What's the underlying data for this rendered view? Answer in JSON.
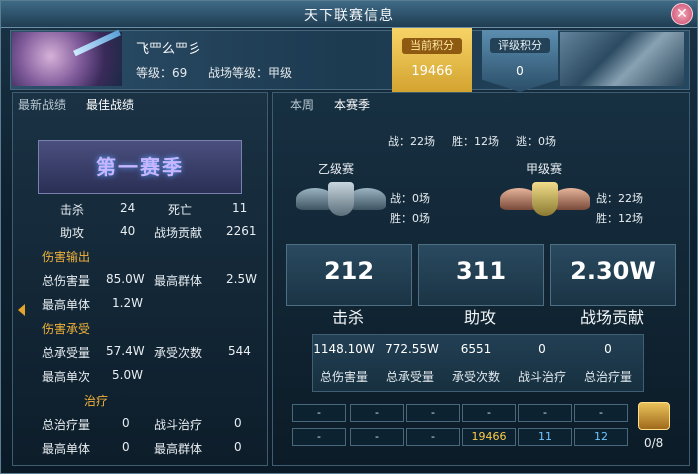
{
  "window": {
    "title": "天下联赛信息"
  },
  "player": {
    "name": "飞罒么罒彡",
    "level": "等级：69",
    "battle_level": "战场等级：甲级"
  },
  "scores": {
    "current_label": "当前积分",
    "current_value": "19466",
    "rating_label": "评级积分",
    "rating_value": "0"
  },
  "left_tabs": [
    "最新战绩",
    "最佳战绩"
  ],
  "right_tabs": [
    "本周",
    "本赛季"
  ],
  "season_banner": "第一赛季",
  "left_stats": {
    "kills_label": "击杀",
    "kills": "24",
    "deaths_label": "死亡",
    "deaths": "11",
    "assists_label": "助攻",
    "assists": "40",
    "contrib_label": "战场贡献",
    "contrib": "2261",
    "damage_section": "伤害输出",
    "total_damage_label": "总伤害量",
    "total_damage": "85.0W",
    "max_aoe_label": "最高群体",
    "max_aoe": "2.5W",
    "max_single_label": "最高单体",
    "max_single": "1.2W",
    "taken_section": "伤害承受",
    "total_taken_label": "总承受量",
    "total_taken": "57.4W",
    "taken_count_label": "承受次数",
    "taken_count": "544",
    "max_taken_label": "最高单次",
    "max_taken": "5.0W",
    "heal_section": "治疗",
    "total_heal_label": "总治疗量",
    "total_heal": "0",
    "battle_heal_label": "战斗治疗",
    "battle_heal": "0",
    "heal_single_label": "最高单体",
    "heal_single": "0",
    "heal_aoe_label": "最高群体",
    "heal_aoe": "0"
  },
  "summary": {
    "battles": "战：22场",
    "wins": "胜：12场",
    "escapes": "逃：0场"
  },
  "leagues": {
    "b": {
      "name": "乙级赛",
      "battles": "战：0场",
      "wins": "胜：0场"
    },
    "a": {
      "name": "甲级赛",
      "battles": "战：22场",
      "wins": "胜：12场"
    }
  },
  "big_stats": [
    {
      "value": "212",
      "label": "击杀"
    },
    {
      "value": "311",
      "label": "助攻"
    },
    {
      "value": "2.30W",
      "label": "战场贡献"
    }
  ],
  "detail_stats": [
    {
      "value": "1148.10W",
      "label": "总伤害量"
    },
    {
      "value": "772.55W",
      "label": "总承受量"
    },
    {
      "value": "6551",
      "label": "承受次数"
    },
    {
      "value": "0",
      "label": "战斗治疗"
    },
    {
      "value": "0",
      "label": "总治疗量"
    }
  ],
  "grid_row1": [
    "-",
    "-",
    "-",
    "-",
    "-",
    "-"
  ],
  "grid_row2": [
    "-",
    "-",
    "-",
    "19466",
    "11",
    "12"
  ],
  "chest": {
    "count": "0/8",
    "icon": "treasure-chest-icon"
  },
  "colors": {
    "gold": "#f7d467",
    "section": "#f0b23a",
    "accent_blue": "#6ec4ff"
  }
}
